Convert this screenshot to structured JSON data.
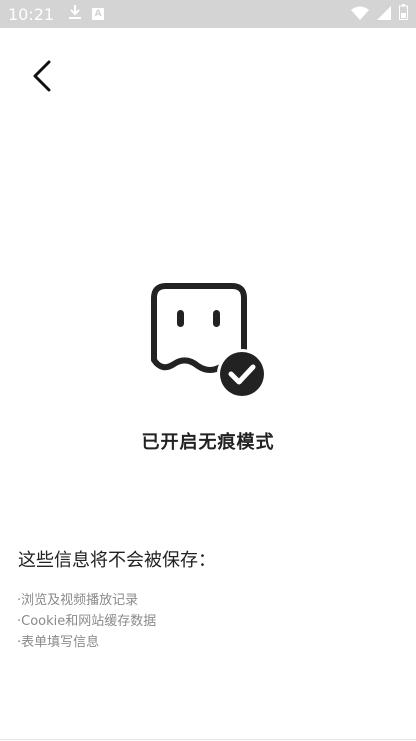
{
  "status_bar": {
    "time": "10:21",
    "left_icons": [
      "download-icon",
      "a-badge-icon"
    ],
    "right_icons": [
      "wifi-icon",
      "signal-icon",
      "battery-icon"
    ],
    "a_badge": "A",
    "background": "#d4d4d4"
  },
  "nav": {
    "back_icon": "chevron-left-icon"
  },
  "hero": {
    "icon": "ghost-check-icon",
    "title": "已开启无痕模式"
  },
  "info": {
    "heading": "这些信息将不会被保存：",
    "items": [
      "·浏览及视频播放记录",
      "·Cookie和网站缓存数据",
      "·表单填写信息"
    ]
  },
  "colors": {
    "primary_text": "#222222",
    "secondary_text": "#8a8a8a",
    "icon_dark": "#222222"
  }
}
